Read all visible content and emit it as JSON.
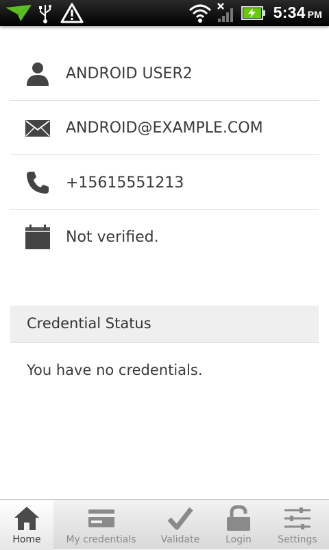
{
  "status_bar": {
    "time": "5:34",
    "ampm": "PM",
    "icons": [
      "notification-arrow-icon",
      "usb-icon",
      "warning-icon",
      "wifi-icon",
      "no-signal-icon",
      "battery-charging-icon"
    ]
  },
  "profile": {
    "name": "ANDROID USER2",
    "email": "ANDROID@EXAMPLE.COM",
    "phone": "+15615551213",
    "verification": "Not verified."
  },
  "credentials": {
    "header": "Credential Status",
    "empty_message": "You have no credentials."
  },
  "tabs": [
    {
      "label": "Home",
      "icon": "home-icon",
      "active": true
    },
    {
      "label": "My credentials",
      "icon": "credit-card-icon",
      "active": false
    },
    {
      "label": "Validate",
      "icon": "checkmark-icon",
      "active": false
    },
    {
      "label": "Login",
      "icon": "unlock-icon",
      "active": false
    },
    {
      "label": "Settings",
      "icon": "sliders-icon",
      "active": false
    }
  ],
  "colors": {
    "status_bar": "#000000",
    "background": "#ffffff",
    "divider": "#dcdcdc",
    "section_header_bg": "#efefef",
    "icon": "#444444",
    "battery_green": "#66cc00",
    "notification_green": "#5bbf21"
  }
}
